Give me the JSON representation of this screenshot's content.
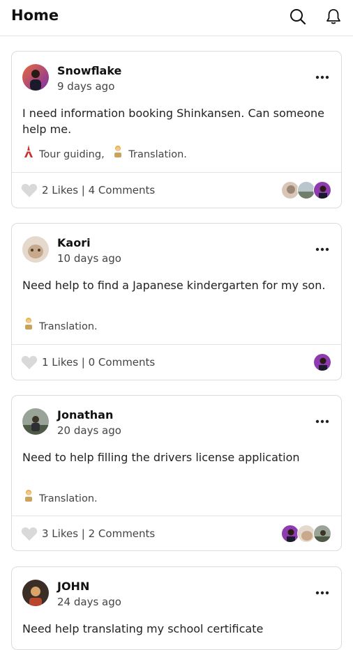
{
  "header": {
    "title": "Home",
    "search_icon": "search-icon",
    "notification_icon": "bell-icon"
  },
  "posts": [
    {
      "author": "Snowflake",
      "time": "9 days ago",
      "text": "I need information booking Shinkansen. Can someone help me.",
      "tags": [
        {
          "icon": "tokyo-tower-icon",
          "label": "Tour guiding,"
        },
        {
          "icon": "translator-person-icon",
          "label": "Translation."
        }
      ],
      "stats": "2 Likes | 4 Comments"
    },
    {
      "author": "Kaori",
      "time": "10 days ago",
      "text": "Need help to find a Japanese kindergarten for my son.",
      "tags": [
        {
          "icon": "translator-person-icon",
          "label": "Translation."
        }
      ],
      "stats": "1 Likes | 0 Comments"
    },
    {
      "author": "Jonathan",
      "time": "20 days ago",
      "text": "Need to help filling the drivers license application",
      "tags": [
        {
          "icon": "translator-person-icon",
          "label": "Translation."
        }
      ],
      "stats": "3 Likes | 2 Comments"
    },
    {
      "author": "JOHN",
      "time": "24 days ago",
      "text": "Need help translating my school certificate"
    }
  ],
  "colors": {
    "accent_avatar": "#8e3bb0",
    "heart": "#d9d9d9",
    "border": "#dcdcdc"
  }
}
